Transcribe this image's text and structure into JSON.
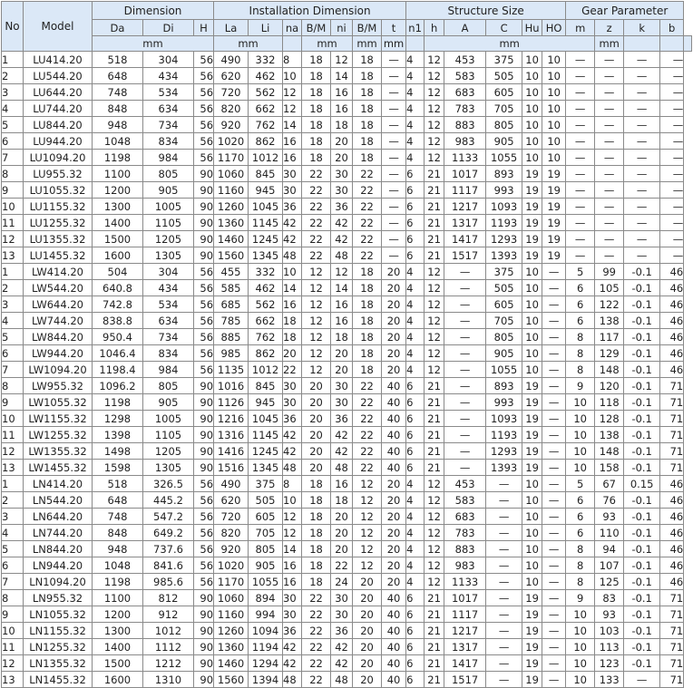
{
  "header": {
    "no": "No",
    "model": "Model",
    "groups": [
      "Dimension",
      "Installation Dimension",
      "Structure Size",
      "Gear Parameter"
    ],
    "columns": [
      "Da",
      "Di",
      "H",
      "La",
      "Li",
      "na",
      "B/M",
      "ni",
      "B/M",
      "t",
      "n1",
      "h",
      "A",
      "C",
      "Hu",
      "HO",
      "m",
      "z",
      "k",
      "b"
    ],
    "units": {
      "dim": "mm",
      "inst1": "mm",
      "inst2": "mm",
      "inst3": "mm",
      "inst4": "mm",
      "struct": "mm",
      "gear": "mm"
    }
  },
  "rows": [
    [
      "1",
      "LU414.20",
      "518",
      "304",
      "56",
      "490",
      "332",
      "8",
      "18",
      "12",
      "18",
      "—",
      "4",
      "12",
      "453",
      "375",
      "10",
      "10",
      "—",
      "—",
      "—",
      "—"
    ],
    [
      "2",
      "LU544.20",
      "648",
      "434",
      "56",
      "620",
      "462",
      "10",
      "18",
      "14",
      "18",
      "—",
      "4",
      "12",
      "583",
      "505",
      "10",
      "10",
      "—",
      "—",
      "—",
      "—"
    ],
    [
      "3",
      "LU644.20",
      "748",
      "534",
      "56",
      "720",
      "562",
      "12",
      "18",
      "16",
      "18",
      "—",
      "4",
      "12",
      "683",
      "605",
      "10",
      "10",
      "—",
      "—",
      "—",
      "—"
    ],
    [
      "4",
      "LU744.20",
      "848",
      "634",
      "56",
      "820",
      "662",
      "12",
      "18",
      "16",
      "18",
      "—",
      "4",
      "12",
      "783",
      "705",
      "10",
      "10",
      "—",
      "—",
      "—",
      "—"
    ],
    [
      "5",
      "LU844.20",
      "948",
      "734",
      "56",
      "920",
      "762",
      "14",
      "18",
      "18",
      "18",
      "—",
      "4",
      "12",
      "883",
      "805",
      "10",
      "10",
      "—",
      "—",
      "—",
      "—"
    ],
    [
      "6",
      "LU944.20",
      "1048",
      "834",
      "56",
      "1020",
      "862",
      "16",
      "18",
      "20",
      "18",
      "—",
      "4",
      "12",
      "983",
      "905",
      "10",
      "10",
      "—",
      "—",
      "—",
      "—"
    ],
    [
      "7",
      "LU1094.20",
      "1198",
      "984",
      "56",
      "1170",
      "1012",
      "16",
      "18",
      "20",
      "18",
      "—",
      "4",
      "12",
      "1133",
      "1055",
      "10",
      "10",
      "—",
      "—",
      "—",
      "—"
    ],
    [
      "8",
      "LU955.32",
      "1100",
      "805",
      "90",
      "1060",
      "845",
      "30",
      "22",
      "30",
      "22",
      "—",
      "6",
      "21",
      "1017",
      "893",
      "19",
      "19",
      "—",
      "—",
      "—",
      "—"
    ],
    [
      "9",
      "LU1055.32",
      "1200",
      "905",
      "90",
      "1160",
      "945",
      "30",
      "22",
      "30",
      "22",
      "—",
      "6",
      "21",
      "1117",
      "993",
      "19",
      "19",
      "—",
      "—",
      "—",
      "—"
    ],
    [
      "10",
      "LU1155.32",
      "1300",
      "1005",
      "90",
      "1260",
      "1045",
      "36",
      "22",
      "36",
      "22",
      "—",
      "6",
      "21",
      "1217",
      "1093",
      "19",
      "19",
      "—",
      "—",
      "—",
      "—"
    ],
    [
      "11",
      "LU1255.32",
      "1400",
      "1105",
      "90",
      "1360",
      "1145",
      "42",
      "22",
      "42",
      "22",
      "—",
      "6",
      "21",
      "1317",
      "1193",
      "19",
      "19",
      "—",
      "—",
      "—",
      "—"
    ],
    [
      "12",
      "LU1355.32",
      "1500",
      "1205",
      "90",
      "1460",
      "1245",
      "42",
      "22",
      "42",
      "22",
      "—",
      "6",
      "21",
      "1417",
      "1293",
      "19",
      "19",
      "—",
      "—",
      "—",
      "—"
    ],
    [
      "13",
      "LU1455.32",
      "1600",
      "1305",
      "90",
      "1560",
      "1345",
      "48",
      "22",
      "48",
      "22",
      "—",
      "6",
      "21",
      "1517",
      "1393",
      "19",
      "19",
      "—",
      "—",
      "—",
      "—"
    ],
    [
      "1",
      "LW414.20",
      "504",
      "304",
      "56",
      "455",
      "332",
      "10",
      "12",
      "12",
      "18",
      "20",
      "4",
      "12",
      "—",
      "375",
      "10",
      "—",
      "5",
      "99",
      "-0.1",
      "46"
    ],
    [
      "2",
      "LW544.20",
      "640.8",
      "434",
      "56",
      "585",
      "462",
      "14",
      "12",
      "14",
      "18",
      "20",
      "4",
      "12",
      "—",
      "505",
      "10",
      "—",
      "6",
      "105",
      "-0.1",
      "46"
    ],
    [
      "3",
      "LW644.20",
      "742.8",
      "534",
      "56",
      "685",
      "562",
      "16",
      "12",
      "16",
      "18",
      "20",
      "4",
      "12",
      "—",
      "605",
      "10",
      "—",
      "6",
      "122",
      "-0.1",
      "46"
    ],
    [
      "4",
      "LW744.20",
      "838.8",
      "634",
      "56",
      "785",
      "662",
      "18",
      "12",
      "16",
      "18",
      "20",
      "4",
      "12",
      "—",
      "705",
      "10",
      "—",
      "6",
      "138",
      "-0.1",
      "46"
    ],
    [
      "5",
      "LW844.20",
      "950.4",
      "734",
      "56",
      "885",
      "762",
      "18",
      "12",
      "18",
      "18",
      "20",
      "4",
      "12",
      "—",
      "805",
      "10",
      "—",
      "8",
      "117",
      "-0.1",
      "46"
    ],
    [
      "6",
      "LW944.20",
      "1046.4",
      "834",
      "56",
      "985",
      "862",
      "20",
      "12",
      "20",
      "18",
      "20",
      "4",
      "12",
      "—",
      "905",
      "10",
      "—",
      "8",
      "129",
      "-0.1",
      "46"
    ],
    [
      "7",
      "LW1094.20",
      "1198.4",
      "984",
      "56",
      "1135",
      "1012",
      "22",
      "12",
      "20",
      "18",
      "20",
      "4",
      "12",
      "—",
      "1055",
      "10",
      "—",
      "8",
      "148",
      "-0.1",
      "46"
    ],
    [
      "8",
      "LW955.32",
      "1096.2",
      "805",
      "90",
      "1016",
      "845",
      "30",
      "20",
      "30",
      "22",
      "40",
      "6",
      "21",
      "—",
      "893",
      "19",
      "—",
      "9",
      "120",
      "-0.1",
      "71"
    ],
    [
      "9",
      "LW1055.32",
      "1198",
      "905",
      "90",
      "1126",
      "945",
      "30",
      "20",
      "30",
      "22",
      "40",
      "6",
      "21",
      "—",
      "993",
      "19",
      "—",
      "10",
      "118",
      "-0.1",
      "71"
    ],
    [
      "10",
      "LW1155.32",
      "1298",
      "1005",
      "90",
      "1216",
      "1045",
      "36",
      "20",
      "36",
      "22",
      "40",
      "6",
      "21",
      "—",
      "1093",
      "19",
      "—",
      "10",
      "128",
      "-0.1",
      "71"
    ],
    [
      "11",
      "LW1255.32",
      "1398",
      "1105",
      "90",
      "1316",
      "1145",
      "42",
      "20",
      "42",
      "22",
      "40",
      "6",
      "21",
      "—",
      "1193",
      "19",
      "—",
      "10",
      "138",
      "-0.1",
      "71"
    ],
    [
      "12",
      "LW1355.32",
      "1498",
      "1205",
      "90",
      "1416",
      "1245",
      "42",
      "20",
      "42",
      "22",
      "40",
      "6",
      "21",
      "—",
      "1293",
      "19",
      "—",
      "10",
      "148",
      "-0.1",
      "71"
    ],
    [
      "13",
      "LW1455.32",
      "1598",
      "1305",
      "90",
      "1516",
      "1345",
      "48",
      "20",
      "48",
      "22",
      "40",
      "6",
      "21",
      "—",
      "1393",
      "19",
      "—",
      "10",
      "158",
      "-0.1",
      "71"
    ],
    [
      "1",
      "LN414.20",
      "518",
      "326.5",
      "56",
      "490",
      "375",
      "8",
      "18",
      "16",
      "12",
      "20",
      "4",
      "12",
      "453",
      "—",
      "10",
      "—",
      "5",
      "67",
      "0.15",
      "46"
    ],
    [
      "2",
      "LN544.20",
      "648",
      "445.2",
      "56",
      "620",
      "505",
      "10",
      "18",
      "18",
      "12",
      "20",
      "4",
      "12",
      "583",
      "—",
      "10",
      "—",
      "6",
      "76",
      "-0.1",
      "46"
    ],
    [
      "3",
      "LN644.20",
      "748",
      "547.2",
      "56",
      "720",
      "605",
      "12",
      "18",
      "20",
      "12",
      "20",
      "4",
      "12",
      "683",
      "—",
      "10",
      "—",
      "6",
      "93",
      "-0.1",
      "46"
    ],
    [
      "4",
      "LN744.20",
      "848",
      "649.2",
      "56",
      "820",
      "705",
      "12",
      "18",
      "20",
      "12",
      "20",
      "4",
      "12",
      "783",
      "—",
      "10",
      "—",
      "6",
      "110",
      "-0.1",
      "46"
    ],
    [
      "5",
      "LN844.20",
      "948",
      "737.6",
      "56",
      "920",
      "805",
      "14",
      "18",
      "20",
      "12",
      "20",
      "4",
      "12",
      "883",
      "—",
      "10",
      "—",
      "8",
      "94",
      "-0.1",
      "46"
    ],
    [
      "6",
      "LN944.20",
      "1048",
      "841.6",
      "56",
      "1020",
      "905",
      "16",
      "18",
      "22",
      "12",
      "20",
      "4",
      "12",
      "983",
      "—",
      "10",
      "—",
      "8",
      "107",
      "-0.1",
      "46"
    ],
    [
      "7",
      "LN1094.20",
      "1198",
      "985.6",
      "56",
      "1170",
      "1055",
      "16",
      "18",
      "24",
      "20",
      "20",
      "4",
      "12",
      "1133",
      "—",
      "10",
      "—",
      "8",
      "125",
      "-0.1",
      "46"
    ],
    [
      "8",
      "LN955.32",
      "1100",
      "812",
      "90",
      "1060",
      "894",
      "30",
      "22",
      "30",
      "20",
      "40",
      "6",
      "21",
      "1017",
      "—",
      "19",
      "—",
      "9",
      "83",
      "-0.1",
      "71"
    ],
    [
      "9",
      "LN1055.32",
      "1200",
      "912",
      "90",
      "1160",
      "994",
      "30",
      "22",
      "30",
      "20",
      "40",
      "6",
      "21",
      "1117",
      "—",
      "19",
      "—",
      "10",
      "93",
      "-0.1",
      "71"
    ],
    [
      "10",
      "LN1155.32",
      "1300",
      "1012",
      "90",
      "1260",
      "1094",
      "36",
      "22",
      "36",
      "20",
      "40",
      "6",
      "21",
      "1217",
      "—",
      "19",
      "—",
      "10",
      "103",
      "-0.1",
      "71"
    ],
    [
      "11",
      "LN1255.32",
      "1400",
      "1112",
      "90",
      "1360",
      "1194",
      "42",
      "22",
      "42",
      "20",
      "40",
      "6",
      "21",
      "1317",
      "—",
      "19",
      "—",
      "10",
      "113",
      "-0.1",
      "71"
    ],
    [
      "12",
      "LN1355.32",
      "1500",
      "1212",
      "90",
      "1460",
      "1294",
      "42",
      "22",
      "42",
      "20",
      "40",
      "6",
      "21",
      "1417",
      "—",
      "19",
      "—",
      "10",
      "123",
      "-0.1",
      "71"
    ],
    [
      "13",
      "LN1455.32",
      "1600",
      "1310",
      "90",
      "1560",
      "1394",
      "48",
      "22",
      "48",
      "20",
      "40",
      "6",
      "21",
      "1517",
      "—",
      "19",
      "—",
      "10",
      "133",
      "—",
      "71"
    ]
  ]
}
